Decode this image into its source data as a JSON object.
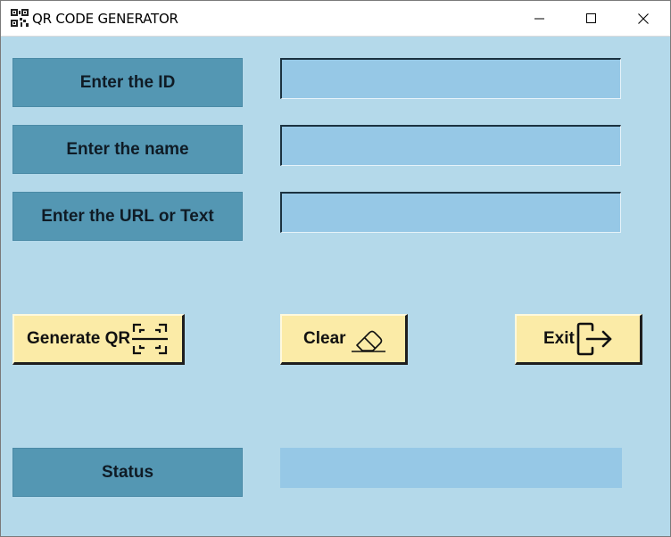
{
  "window": {
    "title": "QR CODE GENERATOR",
    "controls": {
      "minimize": "minimize",
      "maximize": "maximize",
      "close": "close"
    }
  },
  "form": {
    "id_label": "Enter the ID",
    "id_value": "",
    "name_label": "Enter the name",
    "name_value": "",
    "url_label": "Enter the URL or Text",
    "url_value": ""
  },
  "buttons": {
    "generate_label": "Generate QR",
    "generate_icon": "qr-scan-icon",
    "clear_label": "Clear",
    "clear_icon": "eraser-icon",
    "exit_label": "Exit",
    "exit_icon": "logout-arrow-icon"
  },
  "status": {
    "label": "Status",
    "value": ""
  },
  "colors": {
    "background": "#b4d9ea",
    "label_box": "#5497b3",
    "entry": "#96c8e6",
    "button": "#fbeba7"
  }
}
